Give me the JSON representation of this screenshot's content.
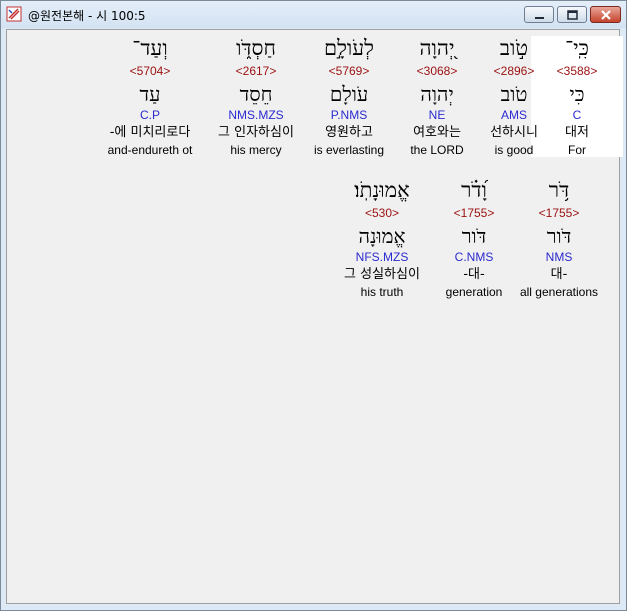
{
  "window": {
    "title": "@원전본해 - 시 100:5"
  },
  "rows": [
    {
      "words": [
        {
          "hebrew": "כִּֽי־",
          "strong": "<3588>",
          "lemma": "כִּי",
          "parse": "C",
          "korean": "대저",
          "english": "For",
          "highlight": true
        },
        {
          "hebrew": "טֹ֣וב",
          "strong": "<2896>",
          "lemma": "טֹוב",
          "parse": "AMS",
          "korean": "선하시니",
          "english": "is good",
          "highlight": false
        },
        {
          "hebrew": "יְ֭הוָה",
          "strong": "<3068>",
          "lemma": "יְהוָה",
          "parse": "NE",
          "korean": "여호와는",
          "english": "the LORD",
          "highlight": false
        },
        {
          "hebrew": "לְעֹולָ֣ם",
          "strong": "<5769>",
          "lemma": "עֹולָם",
          "parse": "P.NMS",
          "korean": "영원하고",
          "english": "is everlasting",
          "highlight": false
        },
        {
          "hebrew": "חַסְדֹּ֑ו",
          "strong": "<2617>",
          "lemma": "חֵסֵד",
          "parse": "NMS.MZS",
          "korean": "그 인자하심이",
          "english": "his mercy",
          "highlight": false
        },
        {
          "hebrew": "וְעַד־",
          "strong": "<5704>",
          "lemma": "עַד",
          "parse": "C.P",
          "korean": "-에 미치리로다",
          "english": "and-endureth ot",
          "highlight": false
        }
      ]
    },
    {
      "words": [
        {
          "hebrew": "דֹּ֥ר",
          "strong": "<1755>",
          "lemma": "דֹּור",
          "parse": "NMS",
          "korean": "대-",
          "english": "all generations",
          "highlight": false
        },
        {
          "hebrew": "וָ֝דֹ֗ר",
          "strong": "<1755>",
          "lemma": "דֹּור",
          "parse": "C.NMS",
          "korean": "-대-",
          "english": "generation",
          "highlight": false
        },
        {
          "hebrew": "אֱמוּנָתֹֽו׃",
          "strong": "<530>",
          "lemma": "אֱמוּנָה",
          "parse": "NFS.MZS",
          "korean": "그 성실하심이",
          "english": "his truth",
          "highlight": false
        }
      ]
    }
  ]
}
